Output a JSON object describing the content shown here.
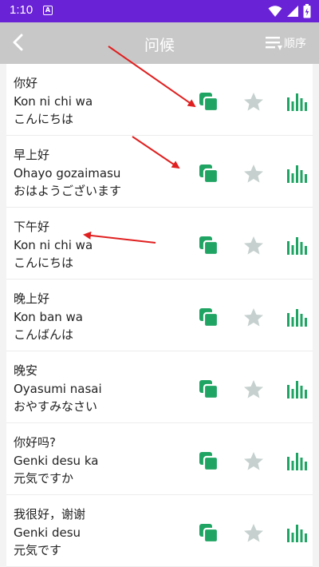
{
  "status": {
    "time": "1:10",
    "notif_letter": "A"
  },
  "toolbar": {
    "title": "问候",
    "order_label": "顺序"
  },
  "items": [
    {
      "chinese": "你好",
      "romaji": "Kon ni chi wa",
      "japanese": "こんにちは"
    },
    {
      "chinese": "早上好",
      "romaji": "Ohayo gozaimasu",
      "japanese": "おはようございます"
    },
    {
      "chinese": "下午好",
      "romaji": "Kon ni chi wa",
      "japanese": "こんにちは"
    },
    {
      "chinese": "晚上好",
      "romaji": "Kon ban wa",
      "japanese": "こんばんは"
    },
    {
      "chinese": "晚安",
      "romaji": "Oyasumi nasai",
      "japanese": "おやすみなさい"
    },
    {
      "chinese": "你好吗?",
      "romaji": "Genki desu ka",
      "japanese": "元気ですか"
    },
    {
      "chinese": "我很好，谢谢",
      "romaji": "Genki desu",
      "japanese": "元気です"
    }
  ],
  "icons": {
    "back": "chevron-left-icon",
    "order": "sort-lines-icon",
    "copy": "copy-icon",
    "favorite": "star-icon",
    "stats": "bar-chart-icon"
  },
  "colors": {
    "status_bar": "#6a22d6",
    "toolbar": "#c8c8c8",
    "accent_green": "#1fa463",
    "star_gray": "#c6d1cf",
    "annotation_red": "#e02020"
  }
}
